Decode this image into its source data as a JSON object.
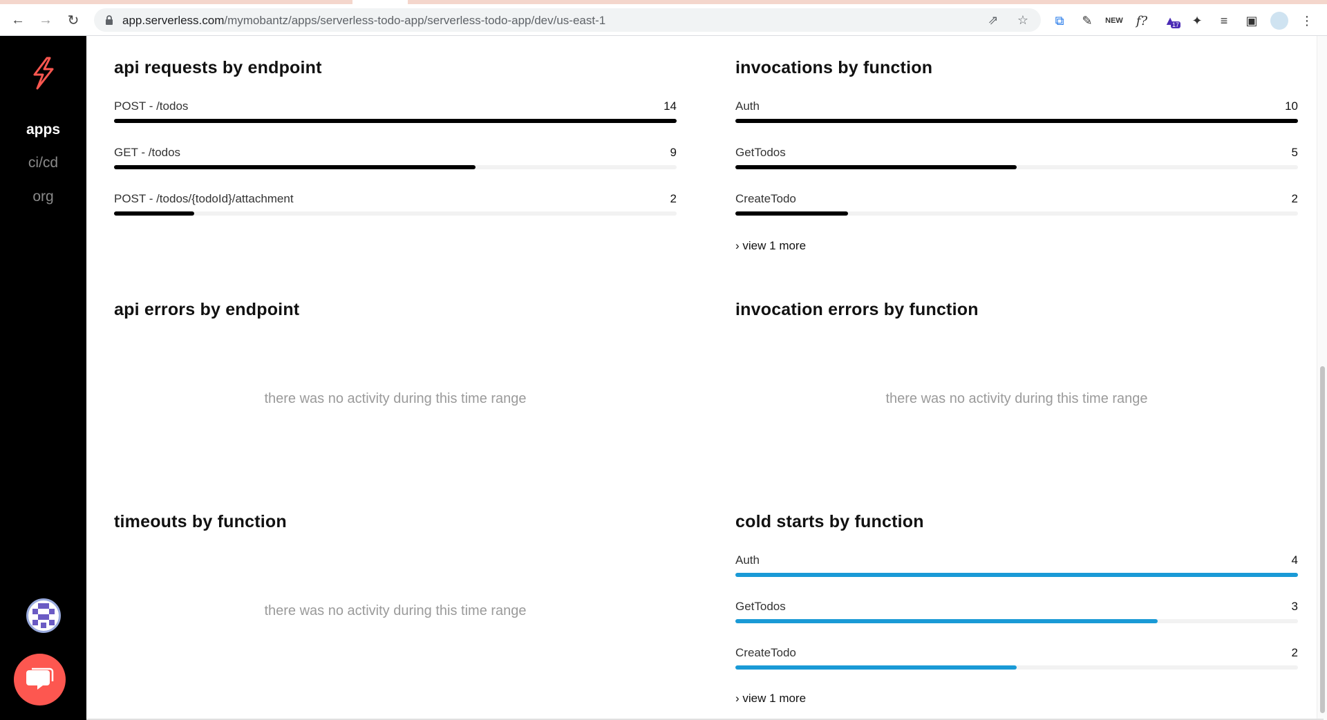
{
  "browser": {
    "url_host": "app.serverless.com",
    "url_path": "/mymobantz/apps/serverless-todo-app/serverless-todo-app/dev/us-east-1",
    "extension_badge": "17"
  },
  "sidebar": {
    "items": [
      {
        "label": "apps",
        "active": true
      },
      {
        "label": "ci/cd",
        "active": false
      },
      {
        "label": "org",
        "active": false
      }
    ]
  },
  "panels": {
    "api_requests": {
      "title": "api requests by endpoint",
      "rows": [
        {
          "label": "POST - /todos",
          "value": "14",
          "fraction": 1.0
        },
        {
          "label": "GET - /todos",
          "value": "9",
          "fraction": 0.643
        },
        {
          "label": "POST - /todos/{todoId}/attachment",
          "value": "2",
          "fraction": 0.143
        }
      ]
    },
    "invocations": {
      "title": "invocations by function",
      "rows": [
        {
          "label": "Auth",
          "value": "10",
          "fraction": 1.0
        },
        {
          "label": "GetTodos",
          "value": "5",
          "fraction": 0.5
        },
        {
          "label": "CreateTodo",
          "value": "2",
          "fraction": 0.2
        }
      ],
      "more": "view 1 more"
    },
    "api_errors": {
      "title": "api errors by endpoint",
      "empty": "there was no activity during this time range"
    },
    "invocation_errors": {
      "title": "invocation errors by function",
      "empty": "there was no activity during this time range"
    },
    "timeouts": {
      "title": "timeouts by function",
      "empty": "there was no activity during this time range"
    },
    "cold_starts": {
      "title": "cold starts by function",
      "rows": [
        {
          "label": "Auth",
          "value": "4",
          "fraction": 1.0
        },
        {
          "label": "GetTodos",
          "value": "3",
          "fraction": 0.75
        },
        {
          "label": "CreateTodo",
          "value": "2",
          "fraction": 0.5
        }
      ],
      "more": "view 1 more"
    }
  },
  "colors": {
    "bar_black": "#000000",
    "bar_blue": "#1a9ad6",
    "brand": "#fd5750"
  }
}
